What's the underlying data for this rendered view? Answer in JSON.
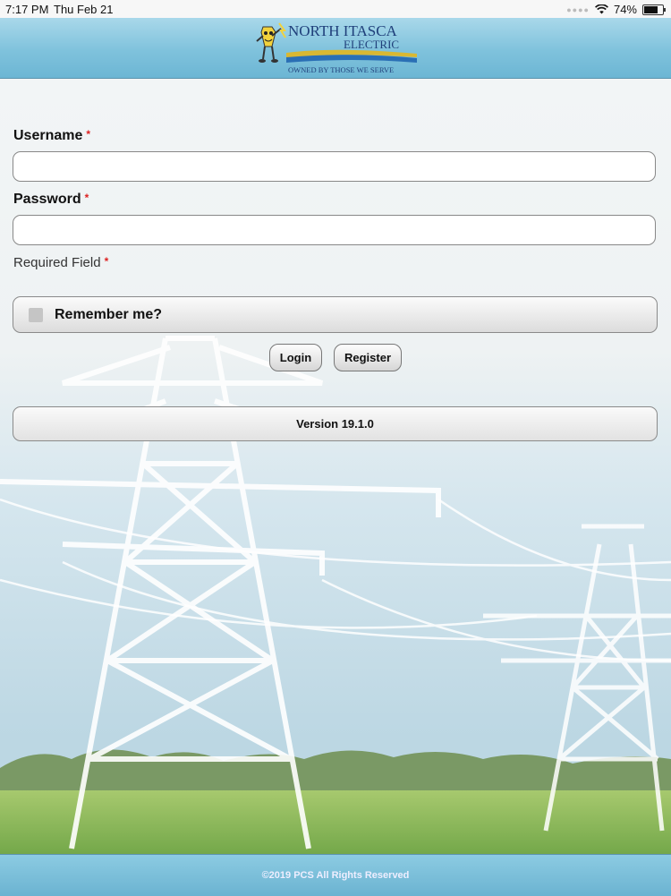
{
  "status_bar": {
    "time": "7:17 PM",
    "date": "Thu Feb 21",
    "battery_percent": "74%",
    "battery_level": 0.74,
    "icons": [
      "cellular-dots-icon",
      "wifi-icon",
      "battery-icon"
    ]
  },
  "header": {
    "logo": {
      "line1": "NORTH ITASCA",
      "line2": "ELECTRIC",
      "tagline": "OWNED BY THOSE WE SERVE"
    }
  },
  "form": {
    "username_label": "Username",
    "password_label": "Password",
    "required_marker": "*",
    "username_value": "",
    "password_value": "",
    "required_field_text": "Required Field",
    "remember_label": "Remember me?",
    "remember_checked": false,
    "login_label": "Login",
    "register_label": "Register"
  },
  "version": {
    "text": "Version 19.1.0"
  },
  "footer": {
    "text": "©2019 PCS All Rights Reserved"
  },
  "colors": {
    "header": "#7fc2dc",
    "required": "#d22222",
    "sky": "#dbe8ee",
    "grass": "#8dbf5a"
  }
}
